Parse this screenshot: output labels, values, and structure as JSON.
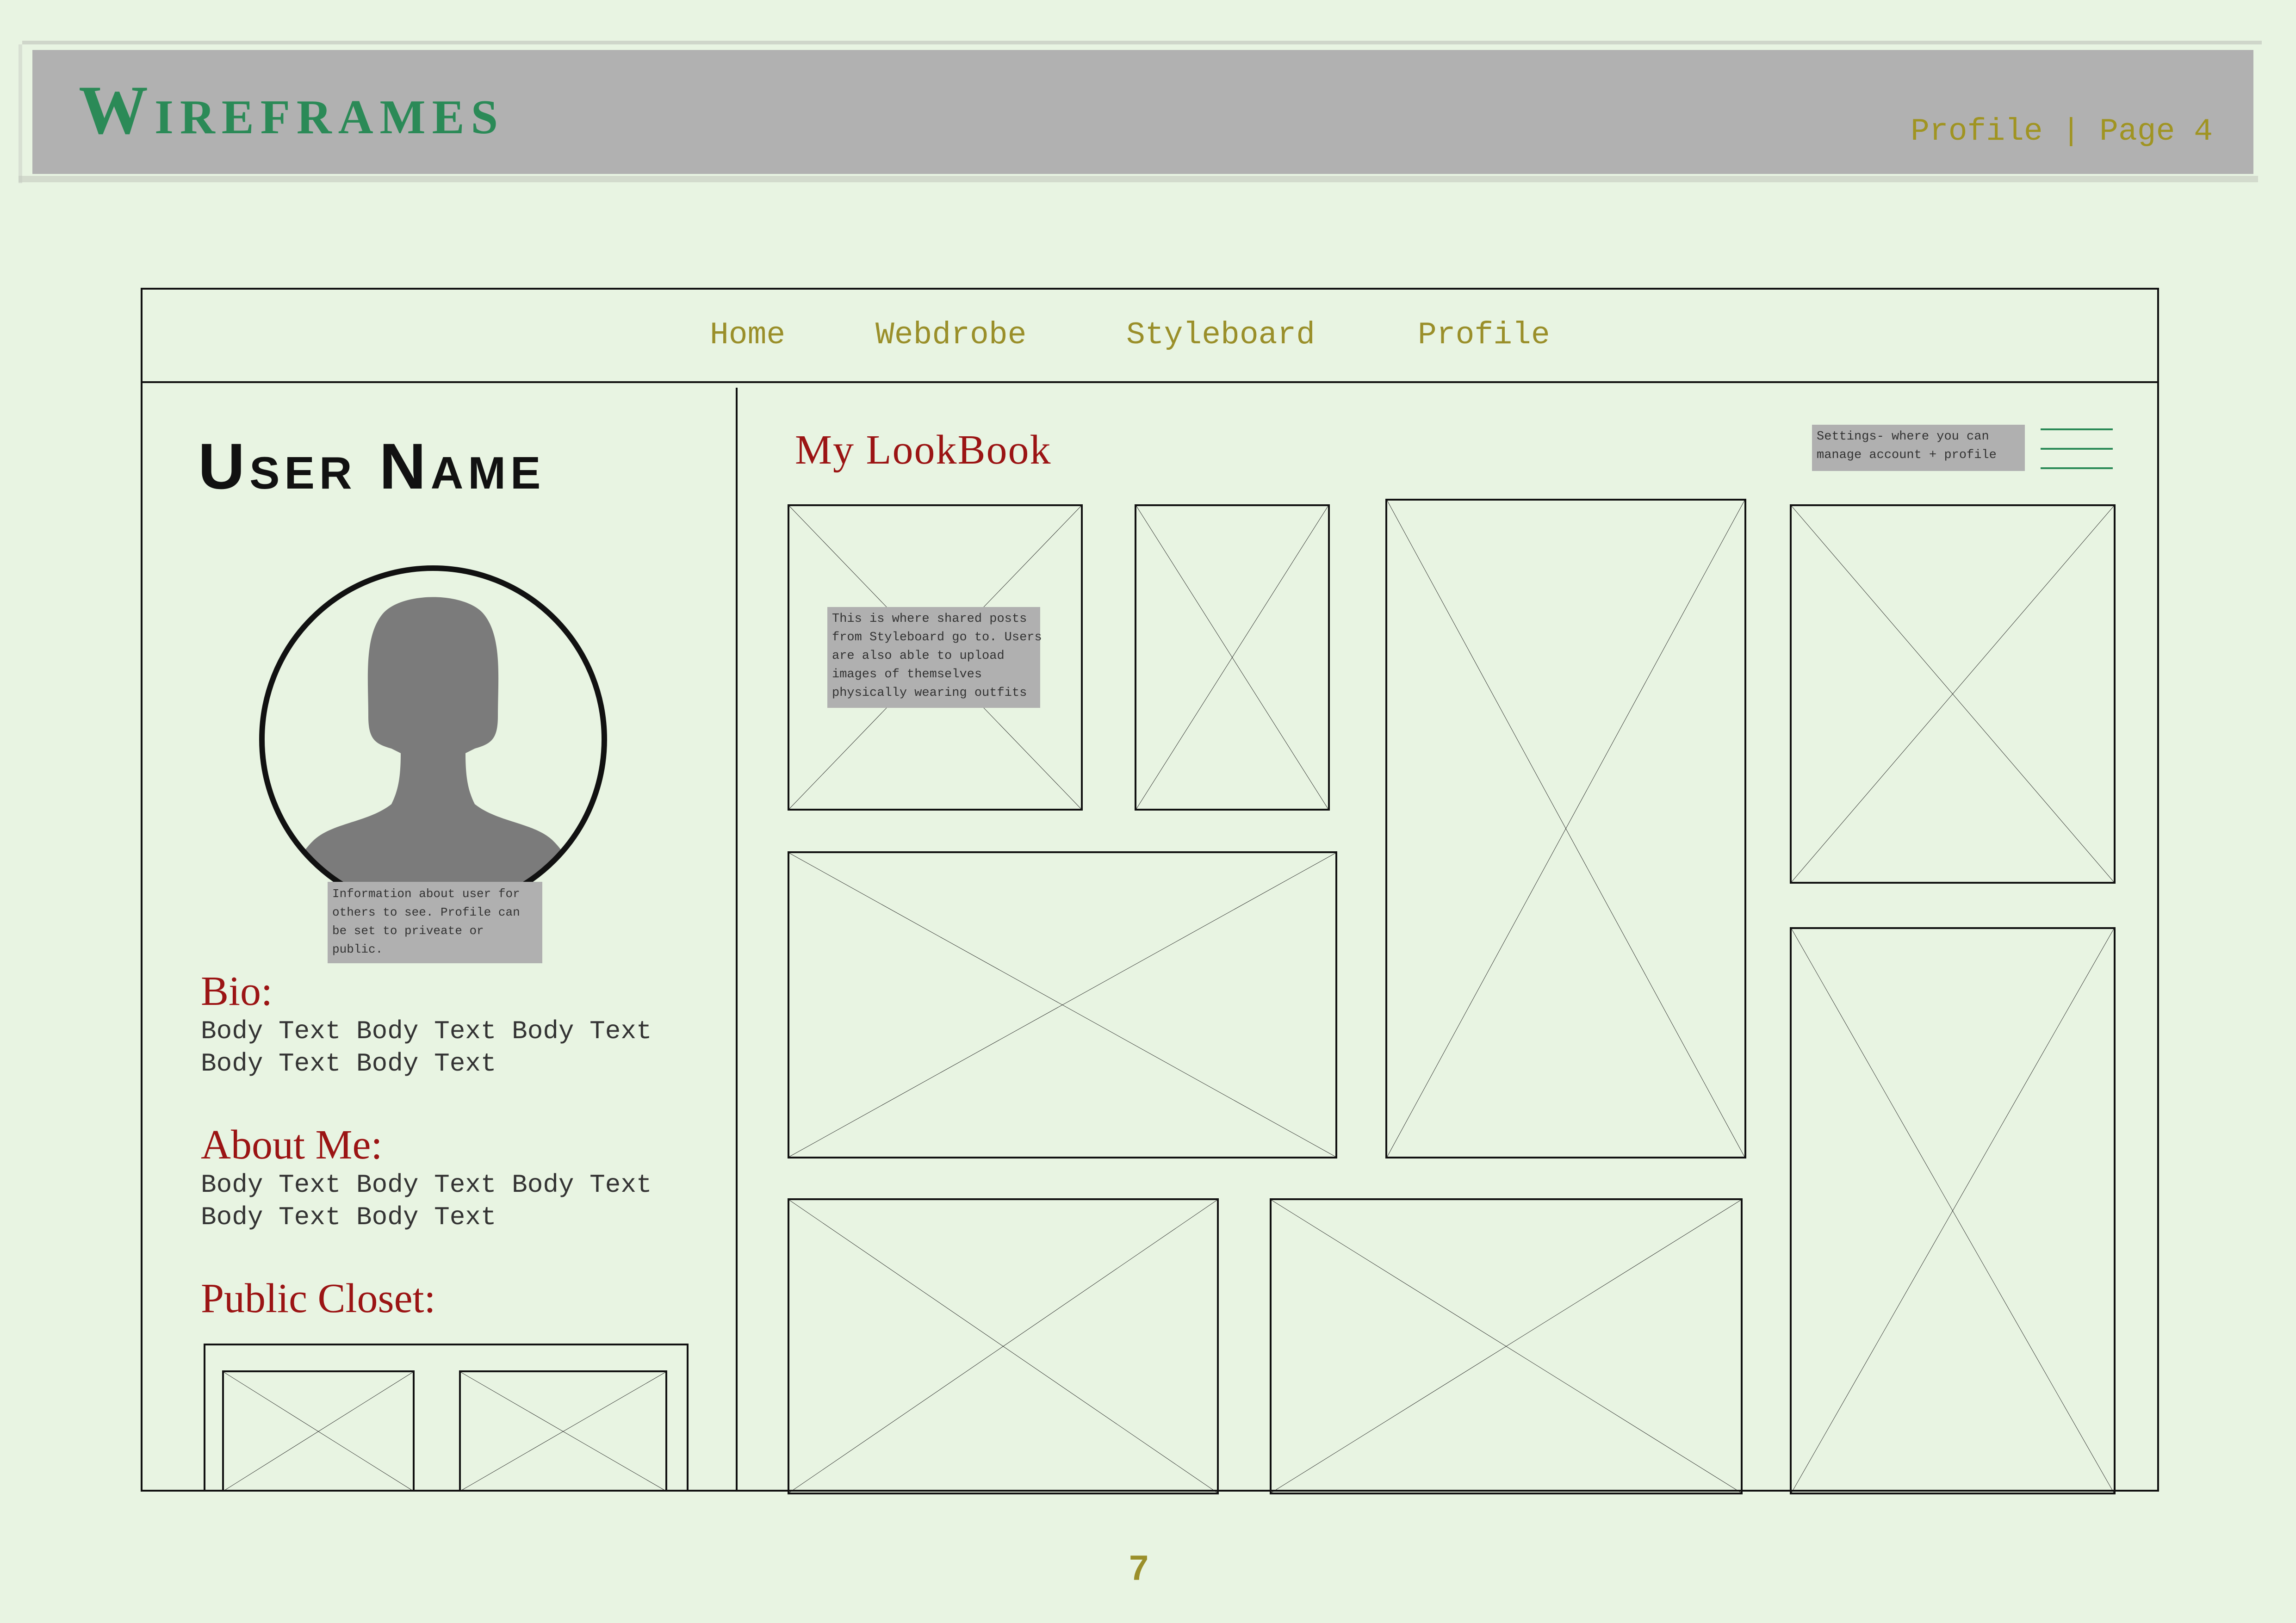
{
  "header": {
    "title": "Wireframes",
    "page_ref": "Profile | Page 4",
    "colors": {
      "title": "#2b8a57",
      "banner": "#b1b1b1",
      "page_ref": "#a09422"
    }
  },
  "nav": {
    "items": [
      "Home",
      "Webdrobe",
      "Styleboard",
      "Profile"
    ],
    "color": "#9a8f2a"
  },
  "profile": {
    "user_name": "User Name",
    "avatar_icon": "user-silhouette-icon",
    "info_note": "Information about user for\nothers to see. Profile can\nbe set to priveate or\npublic.",
    "bio_heading": "Bio:",
    "bio_text": "Body Text Body Text Body Text\nBody Text Body Text",
    "about_heading": "About Me:",
    "about_text": "Body Text Body Text Body Text\nBody Text Body Text",
    "closet_heading": "Public Closet:"
  },
  "lookbook": {
    "title": "My LookBook",
    "posts_note": "This is where shared posts\nfrom Styleboard go to. Users\nare also able to upload\nimages of themselves\nphysically wearing outfits",
    "settings_note": "Settings- where you can\nmanage account + profile",
    "menu_icon": "hamburger-menu-icon"
  },
  "footer": {
    "page_number": "7"
  }
}
